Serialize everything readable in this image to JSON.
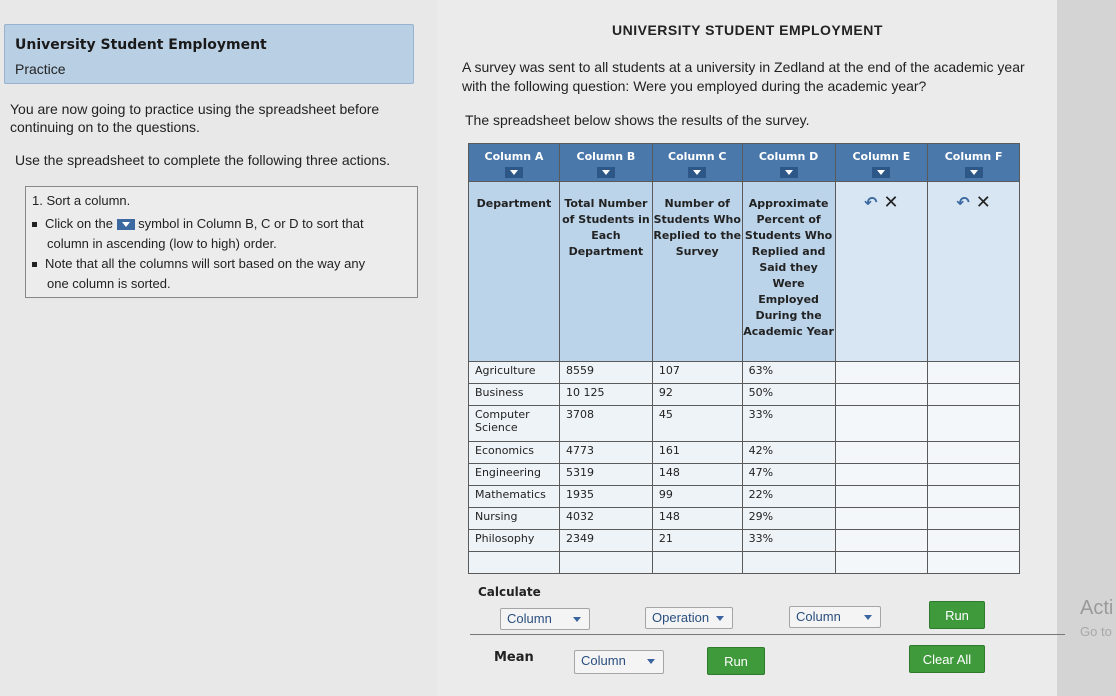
{
  "left": {
    "title": "University Student Employment",
    "subtitle": "Practice",
    "intro": "You are now going to practice using the spreadsheet before continuing on to the questions.",
    "instruction": "Use the spreadsheet to complete the following three actions.",
    "task": {
      "title": "1. Sort a column.",
      "bullet1_pre": "Click on the",
      "bullet1_post": "symbol in Column B, C or D to sort that",
      "bullet1_line2": "column in ascending (low to high) order.",
      "bullet2_line1": "Note that all the columns will sort based on the way any",
      "bullet2_line2": "one column is sorted."
    }
  },
  "right": {
    "heading": "UNIVERSITY STUDENT EMPLOYMENT",
    "description": "A survey was sent to all students at a university in Zedland at the end of the academic year with the following question: Were you employed during the academic year?",
    "description2": "The spreadsheet below shows the results of the survey."
  },
  "sheet": {
    "columns": [
      "Column A",
      "Column B",
      "Column C",
      "Column D",
      "Column E",
      "Column F"
    ],
    "headers": [
      "Department",
      "Total Number of Students in Each Department",
      "Number of Students Who Replied to the Survey",
      "Approximate Percent of Students Who Replied and Said they Were Employed During the Academic Year"
    ],
    "rows": [
      [
        "Agriculture",
        "8559",
        "107",
        "63%"
      ],
      [
        "Business",
        "10 125",
        "92",
        "50%"
      ],
      [
        "Computer Science",
        "3708",
        "45",
        "33%"
      ],
      [
        "Economics",
        "4773",
        "161",
        "42%"
      ],
      [
        "Engineering",
        "5319",
        "148",
        "47%"
      ],
      [
        "Mathematics",
        "1935",
        "99",
        "22%"
      ],
      [
        "Nursing",
        "4032",
        "148",
        "29%"
      ],
      [
        "Philosophy",
        "2349",
        "21",
        "33%"
      ]
    ]
  },
  "calculate": {
    "label": "Calculate",
    "dd_column1": "Column",
    "dd_operation": "Operation",
    "dd_column2": "Column",
    "run1": "Run",
    "mean_label": "Mean",
    "dd_column3": "Column",
    "run2": "Run",
    "clear_all": "Clear All"
  },
  "overlay": {
    "activate": "Acti",
    "goto": "Go to"
  },
  "colors": {
    "column_header": "#4b78aa",
    "title_box": "#b9cfe4",
    "green_button": "#3f9a3c"
  }
}
